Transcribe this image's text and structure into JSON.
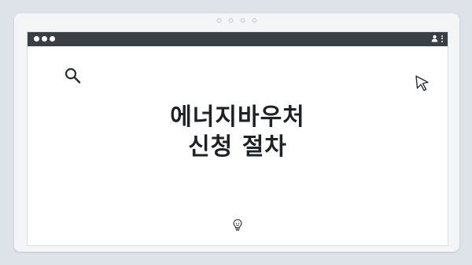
{
  "window": {
    "controls": [
      "close",
      "minimize",
      "maximize"
    ],
    "title_actions": [
      "user-icon",
      "more-options-icon"
    ]
  },
  "content": {
    "headline_line1": "에너지바우처",
    "headline_line2": "신청 절차",
    "icons": [
      "search-icon",
      "cursor-icon",
      "lightbulb-icon"
    ]
  },
  "colors": {
    "background": "#dde3e9",
    "titlebar": "#3a3f45",
    "text": "#1e2225"
  }
}
